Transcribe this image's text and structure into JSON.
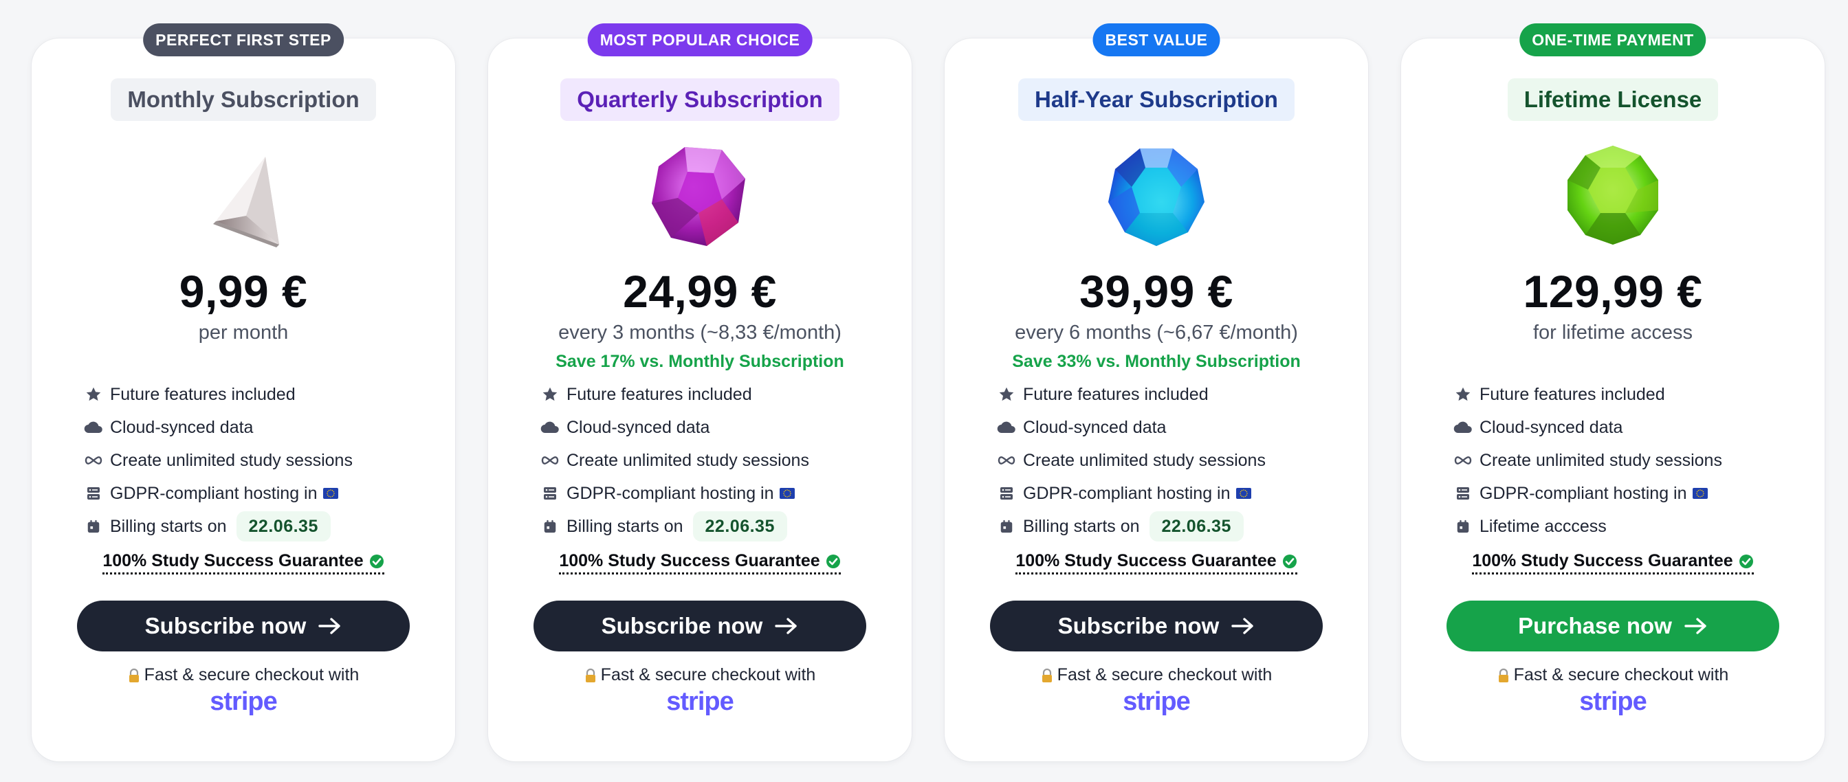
{
  "colors": {
    "dark": "#1e2433",
    "green": "#16a34a",
    "stripe": "#635bff"
  },
  "plans": [
    {
      "badge": "PERFECT FIRST STEP",
      "badge_color": "#4b5061",
      "title": "Monthly Subscription",
      "title_bg": "#f0f2f5",
      "title_color": "#4b5061",
      "gem_icon": "white-diamond-icon",
      "price": "9,99 €",
      "period": "per month",
      "savings": "",
      "features": [
        {
          "icon": "star-icon",
          "text": "Future features included"
        },
        {
          "icon": "cloud-icon",
          "text": "Cloud-synced data"
        },
        {
          "icon": "infinity-icon",
          "text": "Create unlimited study sessions"
        },
        {
          "icon": "server-icon",
          "text": "GDPR-compliant hosting in",
          "flag": "eu-flag-icon"
        },
        {
          "icon": "calendar-icon",
          "text": "Billing starts on",
          "date": "22.06.35"
        }
      ],
      "guarantee": "100% Study Success Guarantee",
      "cta_label": "Subscribe now",
      "cta_color": "#1e2433",
      "checkout_text": "Fast & secure checkout with",
      "stripe_label": "stripe"
    },
    {
      "badge": "MOST POPULAR CHOICE",
      "badge_color": "#7c3aed",
      "title": "Quarterly Subscription",
      "title_bg": "#f1e8fe",
      "title_color": "#5b21b6",
      "gem_icon": "purple-gem-icon",
      "price": "24,99 €",
      "period": "every 3 months (~8,33 €/month)",
      "savings": "Save 17% vs. Monthly Subscription",
      "features": [
        {
          "icon": "star-icon",
          "text": "Future features included"
        },
        {
          "icon": "cloud-icon",
          "text": "Cloud-synced data"
        },
        {
          "icon": "infinity-icon",
          "text": "Create unlimited study sessions"
        },
        {
          "icon": "server-icon",
          "text": "GDPR-compliant hosting in",
          "flag": "eu-flag-icon"
        },
        {
          "icon": "calendar-icon",
          "text": "Billing starts on",
          "date": "22.06.35"
        }
      ],
      "guarantee": "100% Study Success Guarantee",
      "cta_label": "Subscribe now",
      "cta_color": "#1e2433",
      "checkout_text": "Fast & secure checkout with",
      "stripe_label": "stripe"
    },
    {
      "badge": "BEST VALUE",
      "badge_color": "#1677f2",
      "title": "Half-Year Subscription",
      "title_bg": "#e9f1fd",
      "title_color": "#1e3a8a",
      "gem_icon": "blue-gem-icon",
      "price": "39,99 €",
      "period": "every 6 months (~6,67 €/month)",
      "savings": "Save 33% vs. Monthly Subscription",
      "features": [
        {
          "icon": "star-icon",
          "text": "Future features included"
        },
        {
          "icon": "cloud-icon",
          "text": "Cloud-synced data"
        },
        {
          "icon": "infinity-icon",
          "text": "Create unlimited study sessions"
        },
        {
          "icon": "server-icon",
          "text": "GDPR-compliant hosting in",
          "flag": "eu-flag-icon"
        },
        {
          "icon": "calendar-icon",
          "text": "Billing starts on",
          "date": "22.06.35"
        }
      ],
      "guarantee": "100% Study Success Guarantee",
      "cta_label": "Subscribe now",
      "cta_color": "#1e2433",
      "checkout_text": "Fast & secure checkout with",
      "stripe_label": "stripe"
    },
    {
      "badge": "ONE-TIME PAYMENT",
      "badge_color": "#16a34a",
      "title": "Lifetime License",
      "title_bg": "#ecf8ef",
      "title_color": "#14532d",
      "gem_icon": "green-gem-icon",
      "price": "129,99 €",
      "period": "for lifetime access",
      "savings": "",
      "features": [
        {
          "icon": "star-icon",
          "text": "Future features included"
        },
        {
          "icon": "cloud-icon",
          "text": "Cloud-synced data"
        },
        {
          "icon": "infinity-icon",
          "text": "Create unlimited study sessions"
        },
        {
          "icon": "server-icon",
          "text": "GDPR-compliant hosting in",
          "flag": "eu-flag-icon"
        },
        {
          "icon": "calendar-icon",
          "text": "Lifetime acccess"
        }
      ],
      "guarantee": "100% Study Success Guarantee",
      "cta_label": "Purchase now",
      "cta_color": "#16a34a",
      "checkout_text": "Fast & secure checkout with",
      "stripe_label": "stripe"
    }
  ]
}
